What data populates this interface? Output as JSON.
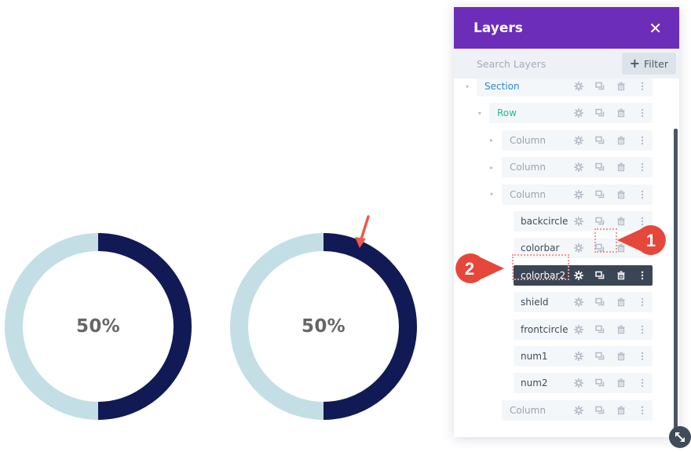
{
  "canvas": {
    "rings": [
      {
        "label": "50%",
        "progress": 0.5,
        "track_color": "#c3dfe5",
        "bar_color": "#121a55"
      },
      {
        "label": "50%",
        "progress": 0.5,
        "track_color": "#c3dfe5",
        "bar_color": "#121a55"
      }
    ]
  },
  "panel": {
    "title": "Layers",
    "close_icon": "close-icon",
    "header_color": "#6c2eb9",
    "search": {
      "placeholder": "Search Layers",
      "value": ""
    },
    "filter_label": "Filter",
    "items": [
      {
        "label": "Section",
        "type": "section",
        "color": "#2e8bc9",
        "toggle": "expanded"
      },
      {
        "label": "Row",
        "type": "row",
        "color": "#29b998",
        "toggle": "expanded"
      },
      {
        "label": "Column",
        "type": "column",
        "color": "#9aa3ae",
        "toggle": "collapsed"
      },
      {
        "label": "Column",
        "type": "column",
        "color": "#9aa3ae",
        "toggle": "collapsed"
      },
      {
        "label": "Column",
        "type": "column",
        "color": "#9aa3ae",
        "toggle": "expanded"
      },
      {
        "label": "backcircle",
        "type": "module",
        "color": "#3f4a57"
      },
      {
        "label": "colorbar",
        "type": "module",
        "color": "#3f4a57"
      },
      {
        "label": "colorbar2",
        "type": "module",
        "color": "#ffffff",
        "selected": true
      },
      {
        "label": "shield",
        "type": "module",
        "color": "#3f4a57"
      },
      {
        "label": "frontcircle",
        "type": "module",
        "color": "#3f4a57"
      },
      {
        "label": "num1",
        "type": "module",
        "color": "#3f4a57"
      },
      {
        "label": "num2",
        "type": "module",
        "color": "#3f4a57"
      },
      {
        "label": "Column",
        "type": "column",
        "color": "#9aa3ae"
      }
    ],
    "item_actions": [
      "gear-icon",
      "duplicate-icon",
      "trash-icon",
      "more-icon"
    ]
  },
  "annotations": {
    "badge_1": "1",
    "badge_2": "2",
    "badge_color": "#e5473b"
  }
}
